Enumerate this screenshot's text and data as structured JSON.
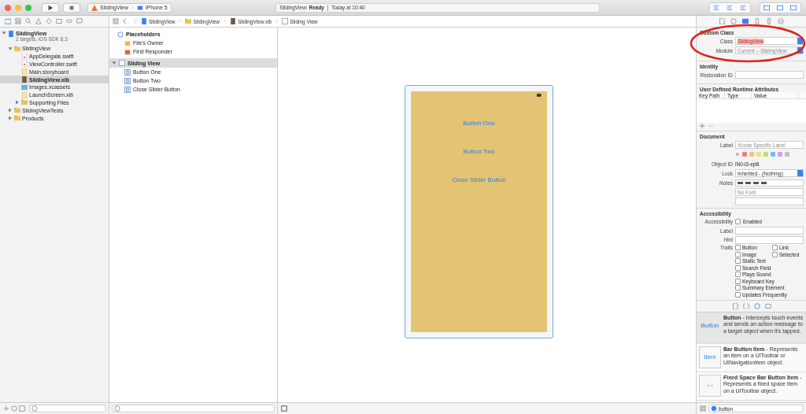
{
  "toolbar": {
    "scheme": "SlidingView",
    "device": "iPhone 5",
    "status": {
      "target": "SlidingView:",
      "state": "Ready",
      "time": "Today at 10:40"
    }
  },
  "jump_bar": [
    {
      "kind": "project",
      "label": "SlidingView"
    },
    {
      "kind": "folder",
      "label": "SlidingView"
    },
    {
      "kind": "xib",
      "label": "SlidingView.xib"
    },
    {
      "kind": "view",
      "label": "Sliding View"
    }
  ],
  "navigator": {
    "project": {
      "name": "SlidingView",
      "subtitle": "2 targets, iOS SDK 8.3",
      "expanded": true
    },
    "items": [
      {
        "kind": "folder",
        "label": "SlidingView",
        "expanded": true,
        "selected": false,
        "children": [
          {
            "kind": "swift",
            "label": "AppDelegate.swift",
            "selected": false
          },
          {
            "kind": "swift",
            "label": "ViewController.swift",
            "selected": false
          },
          {
            "kind": "storyboard",
            "label": "Main.storyboard",
            "selected": false
          },
          {
            "kind": "xib",
            "label": "SlidingView.xib",
            "selected": true
          },
          {
            "kind": "assets",
            "label": "Images.xcassets",
            "selected": false
          },
          {
            "kind": "storyboard",
            "label": "LaunchScreen.xib",
            "selected": false
          },
          {
            "kind": "folder",
            "label": "Supporting Files",
            "expanded": false,
            "selected": false
          }
        ]
      },
      {
        "kind": "folder",
        "label": "SlidingViewTests",
        "expanded": false,
        "selected": false
      },
      {
        "kind": "folder",
        "label": "Products",
        "expanded": false,
        "selected": false
      }
    ]
  },
  "outline": {
    "placeholders": {
      "title": "Placeholders",
      "items": [
        {
          "kind": "owner",
          "label": "File's Owner"
        },
        {
          "kind": "responder",
          "label": "First Responder"
        }
      ]
    },
    "view": {
      "title": "Sliding View",
      "expanded": true,
      "selected": true,
      "items": [
        "Button One",
        "Button Two",
        "Close Slider Button"
      ]
    }
  },
  "canvas": {
    "buttons": [
      "Button One",
      "Button Two",
      "Close Slider Button"
    ]
  },
  "inspector": {
    "custom_class": {
      "title": "Custom Class",
      "class_label": "Class",
      "class_value": "SlidingView",
      "module_label": "Module",
      "module_placeholder": "Current – SlidingView"
    },
    "identity": {
      "title": "Identity",
      "restoration_label": "Restoration ID"
    },
    "runtime_attributes": {
      "title": "User Defined Runtime Attributes",
      "columns": [
        "Key Path",
        "Type",
        "Value"
      ]
    },
    "document": {
      "title": "Document",
      "label_label": "Label",
      "label_placeholder": "Xcode Specific Label",
      "colors": [
        {
          "color": "#f08080"
        },
        {
          "color": "#f5c07a"
        },
        {
          "color": "#f0e070"
        },
        {
          "color": "#b8e070"
        },
        {
          "color": "#7ab8f0"
        },
        {
          "color": "#d0a0e8"
        },
        {
          "color": "#c0c0c0"
        }
      ],
      "object_id_label": "Object ID",
      "object_id": "iN0-l3-epB",
      "lock_label": "Lock",
      "lock_value": "Inherited - (Nothing)",
      "notes_label": "Notes",
      "font_placeholder": "No Font"
    },
    "accessibility": {
      "title": "Accessibility",
      "accessibility_label": "Accessibility",
      "enabled": {
        "label": "Enabled",
        "checked": false
      },
      "label_label": "Label",
      "hint_label": "Hint",
      "traits_label": "Traits",
      "traits": [
        {
          "label": "Button",
          "checked": false
        },
        {
          "label": "Link",
          "checked": false
        },
        {
          "label": "Image",
          "checked": false
        },
        {
          "label": "Selected",
          "checked": false
        },
        {
          "label": "Static Text",
          "checked": false
        },
        {
          "label": "Search Field",
          "checked": false
        },
        {
          "label": "Plays Sound",
          "checked": false
        },
        {
          "label": "Keyboard Key",
          "checked": false
        },
        {
          "label": "Summary Element",
          "checked": false
        },
        {
          "label": "Updates Frequently",
          "checked": false
        }
      ]
    },
    "library": [
      {
        "preview": "Button",
        "title": "Button",
        "description": " - Intercepts touch events and sends an action message to a target object when it's tapped.",
        "selected": true
      },
      {
        "preview": "Item",
        "title": "Bar Button Item",
        "description": " - Represents an item on a UIToolbar or UINavigationItem object.",
        "selected": false
      },
      {
        "kind": "fixed",
        "title": "Fixed Space Bar Button Item",
        "description": " - Represents a fixed space item on a UIToolbar object.",
        "selected": false
      }
    ],
    "library_search": "button"
  }
}
